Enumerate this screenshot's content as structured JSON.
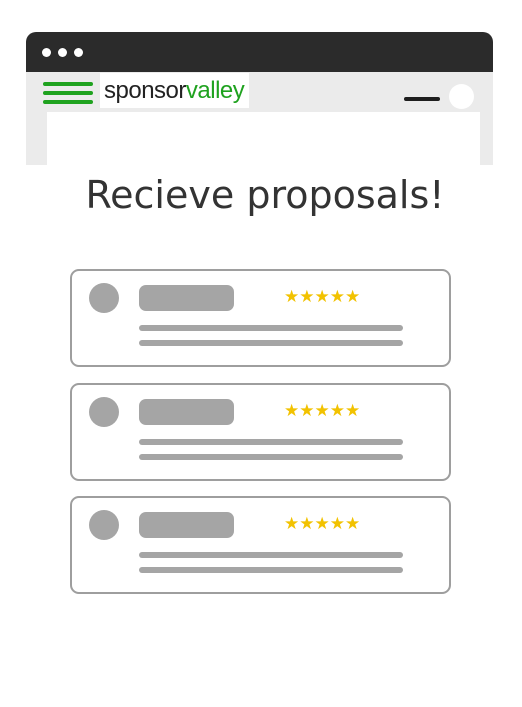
{
  "browser": {
    "logo": {
      "part1": "sponsor",
      "part2": "valley"
    }
  },
  "colors": {
    "brand_green": "#1fa21f",
    "titlebar": "#2b2b2b",
    "placeholder_gray": "#a5a5a5",
    "star_yellow": "#f2c200"
  },
  "heading": "Recieve proposals!",
  "proposals": [
    {
      "stars": "★★★★★",
      "rating": 5
    },
    {
      "stars": "★★★★★",
      "rating": 5
    },
    {
      "stars": "★★★★★",
      "rating": 5
    }
  ]
}
